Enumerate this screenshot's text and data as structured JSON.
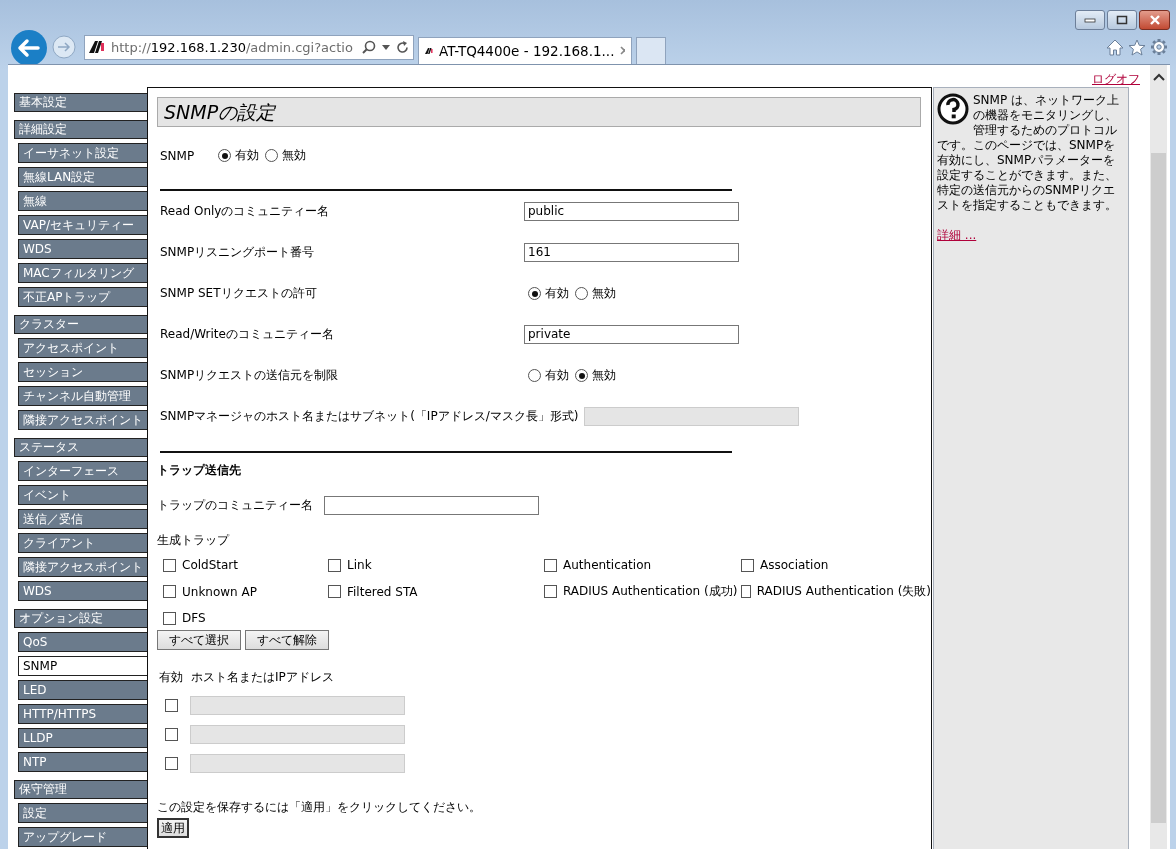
{
  "browser": {
    "url": {
      "scheme": "http://",
      "host": "192.168.1.230",
      "path": "/admin.cgi?actio"
    },
    "tabs": [
      {
        "title": "AT-TQ4400e - 192.168.1...",
        "selected": true
      }
    ]
  },
  "logoff": "ログオフ",
  "sidebar": [
    {
      "label": "基本設定"
    },
    {
      "label": "詳細設定",
      "children": [
        {
          "label": "イーサネット設定",
          "selected": false
        },
        {
          "label": "無線LAN設定",
          "selected": false
        },
        {
          "label": "無線",
          "selected": false
        },
        {
          "label": "VAP/セキュリティー",
          "selected": false
        },
        {
          "label": "WDS",
          "selected": false
        },
        {
          "label": "MACフィルタリング",
          "selected": false
        },
        {
          "label": "不正APトラップ",
          "selected": false
        }
      ]
    },
    {
      "label": "クラスター",
      "children": [
        {
          "label": "アクセスポイント",
          "selected": false
        },
        {
          "label": "セッション",
          "selected": false
        },
        {
          "label": "チャンネル自動管理",
          "selected": false
        },
        {
          "label": "隣接アクセスポイント",
          "selected": false
        }
      ]
    },
    {
      "label": "ステータス",
      "children": [
        {
          "label": "インターフェース",
          "selected": false
        },
        {
          "label": "イベント",
          "selected": false
        },
        {
          "label": "送信／受信",
          "selected": false
        },
        {
          "label": "クライアント",
          "selected": false
        },
        {
          "label": "隣接アクセスポイント",
          "selected": false
        },
        {
          "label": "WDS",
          "selected": false
        }
      ]
    },
    {
      "label": "オプション設定",
      "children": [
        {
          "label": "QoS",
          "selected": false
        },
        {
          "label": "SNMP",
          "selected": true
        },
        {
          "label": "LED",
          "selected": false
        },
        {
          "label": "HTTP/HTTPS",
          "selected": false
        },
        {
          "label": "LLDP",
          "selected": false
        },
        {
          "label": "NTP",
          "selected": false
        }
      ]
    },
    {
      "label": "保守管理",
      "children": [
        {
          "label": "設定",
          "selected": false
        },
        {
          "label": "アップグレード",
          "selected": false
        }
      ]
    }
  ],
  "main": {
    "title": "SNMPの設定",
    "snmp": {
      "label": "SNMP",
      "options": [
        {
          "label": "有効",
          "selected": true
        },
        {
          "label": "無効",
          "selected": false
        }
      ]
    },
    "rows": [
      {
        "kind": "text",
        "label": "Read Onlyのコミュニティー名",
        "value": "public",
        "disabled": false
      },
      {
        "kind": "text",
        "label": "SNMPリスニングポート番号",
        "value": "161",
        "disabled": false
      },
      {
        "kind": "radio",
        "label": "SNMP SETリクエストの許可",
        "options": [
          {
            "label": "有効",
            "selected": true
          },
          {
            "label": "無効",
            "selected": false
          }
        ]
      },
      {
        "kind": "text",
        "label": "Read/Writeのコミュニティー名",
        "value": "private",
        "disabled": false
      },
      {
        "kind": "radio",
        "label": "SNMPリクエストの送信元を制限",
        "options": [
          {
            "label": "有効",
            "selected": false
          },
          {
            "label": "無効",
            "selected": true
          }
        ]
      },
      {
        "kind": "text",
        "label": "SNMPマネージャのホスト名またはサブネット(「IPアドレス/マスク長」形式)",
        "value": "",
        "disabled": true
      }
    ],
    "trap": {
      "heading": "トラップ送信先",
      "community_label": "トラップのコミュニティー名",
      "traps_label": "生成トラップ",
      "traps": [
        {
          "label": "ColdStart",
          "checked": false
        },
        {
          "label": "Link",
          "checked": false
        },
        {
          "label": "Authentication",
          "checked": false
        },
        {
          "label": "Association",
          "checked": false
        },
        {
          "label": "Unknown AP",
          "checked": false
        },
        {
          "label": "Filtered STA",
          "checked": false
        },
        {
          "label": "RADIUS Authentication (成功)",
          "checked": false
        },
        {
          "label": "RADIUS Authentication (失敗)",
          "checked": false
        },
        {
          "label": "DFS",
          "checked": false
        }
      ],
      "buttons": [
        "すべて選択",
        "すべて解除"
      ],
      "host_headers": [
        "有効",
        "ホスト名またはIPアドレス"
      ],
      "hosts": [
        {
          "enabled": false,
          "disabled": true
        },
        {
          "enabled": false,
          "disabled": true
        },
        {
          "enabled": false,
          "disabled": true
        }
      ]
    },
    "save_note": "この設定を保存するには「適用」をクリックしてください。",
    "apply": "適用"
  },
  "help": {
    "text": "SNMP は、ネットワーク上の機器をモニタリングし、管理するためのプロトコルです。このページでは、SNMPを有効にし、SNMPパラメーターを設定することができます。また、特定の送信元からのSNMPリクエストを指定することもできます。",
    "link": "詳細 ..."
  }
}
